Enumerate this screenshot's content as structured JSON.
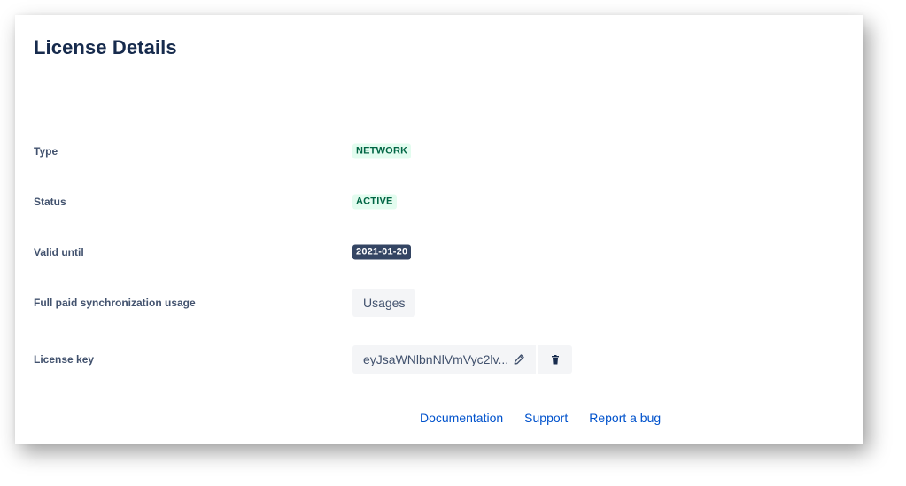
{
  "page": {
    "title": "License Details"
  },
  "fields": {
    "type": {
      "label": "Type",
      "value": "NETWORK"
    },
    "status": {
      "label": "Status",
      "value": "ACTIVE"
    },
    "valid_until": {
      "label": "Valid until",
      "value": "2021-01-20"
    },
    "usage": {
      "label": "Full paid synchronization usage",
      "button_label": "Usages"
    },
    "license_key": {
      "label": "License key",
      "value": "eyJsaWNlbnNlVmVyc2lv..."
    }
  },
  "icons": {
    "edit": "pencil-icon",
    "delete": "trash-icon"
  },
  "footer": {
    "links": [
      "Documentation",
      "Support",
      "Report a bug"
    ]
  },
  "colors": {
    "heading": "#172b4d",
    "label": "#42526e",
    "success_bg": "#e3fcef",
    "success_text": "#006644",
    "date_bg": "#344563",
    "link": "#0052cc",
    "button_bg": "#f4f5f7"
  }
}
